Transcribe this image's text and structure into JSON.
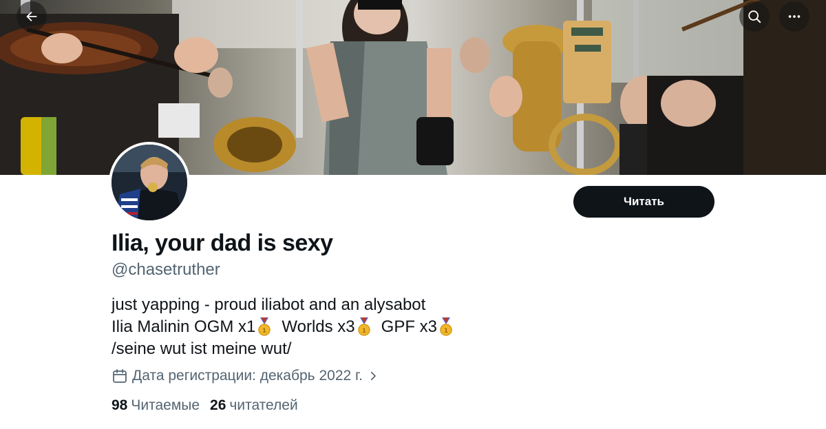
{
  "colors": {
    "text_primary": "#0f1419",
    "text_secondary": "#536471",
    "button_bg": "#0f1419",
    "button_text": "#ffffff",
    "background": "#ffffff"
  },
  "header": {
    "back_icon": "arrow-left-icon",
    "search_icon": "search-icon",
    "more_icon": "more-horizontal-icon"
  },
  "profile": {
    "display_name": "Ilia, your dad is sexy",
    "handle": "@chasetruther",
    "follow_label": "Читать",
    "bio": {
      "line1": "just yapping - proud iliabot and an alysabot",
      "line2_parts": [
        "Ilia Malinin OGM x1",
        "Worlds x3",
        "GPF x3"
      ],
      "line2_icon": "gold-medal-icon",
      "line3": "/seine wut ist meine wut/"
    },
    "joined": "Дата регистрации: декабрь 2022 г.",
    "joined_icon": "calendar-icon",
    "following_count": "98",
    "following_label": "Читаемые",
    "followers_count": "26",
    "followers_label": "читателей"
  }
}
